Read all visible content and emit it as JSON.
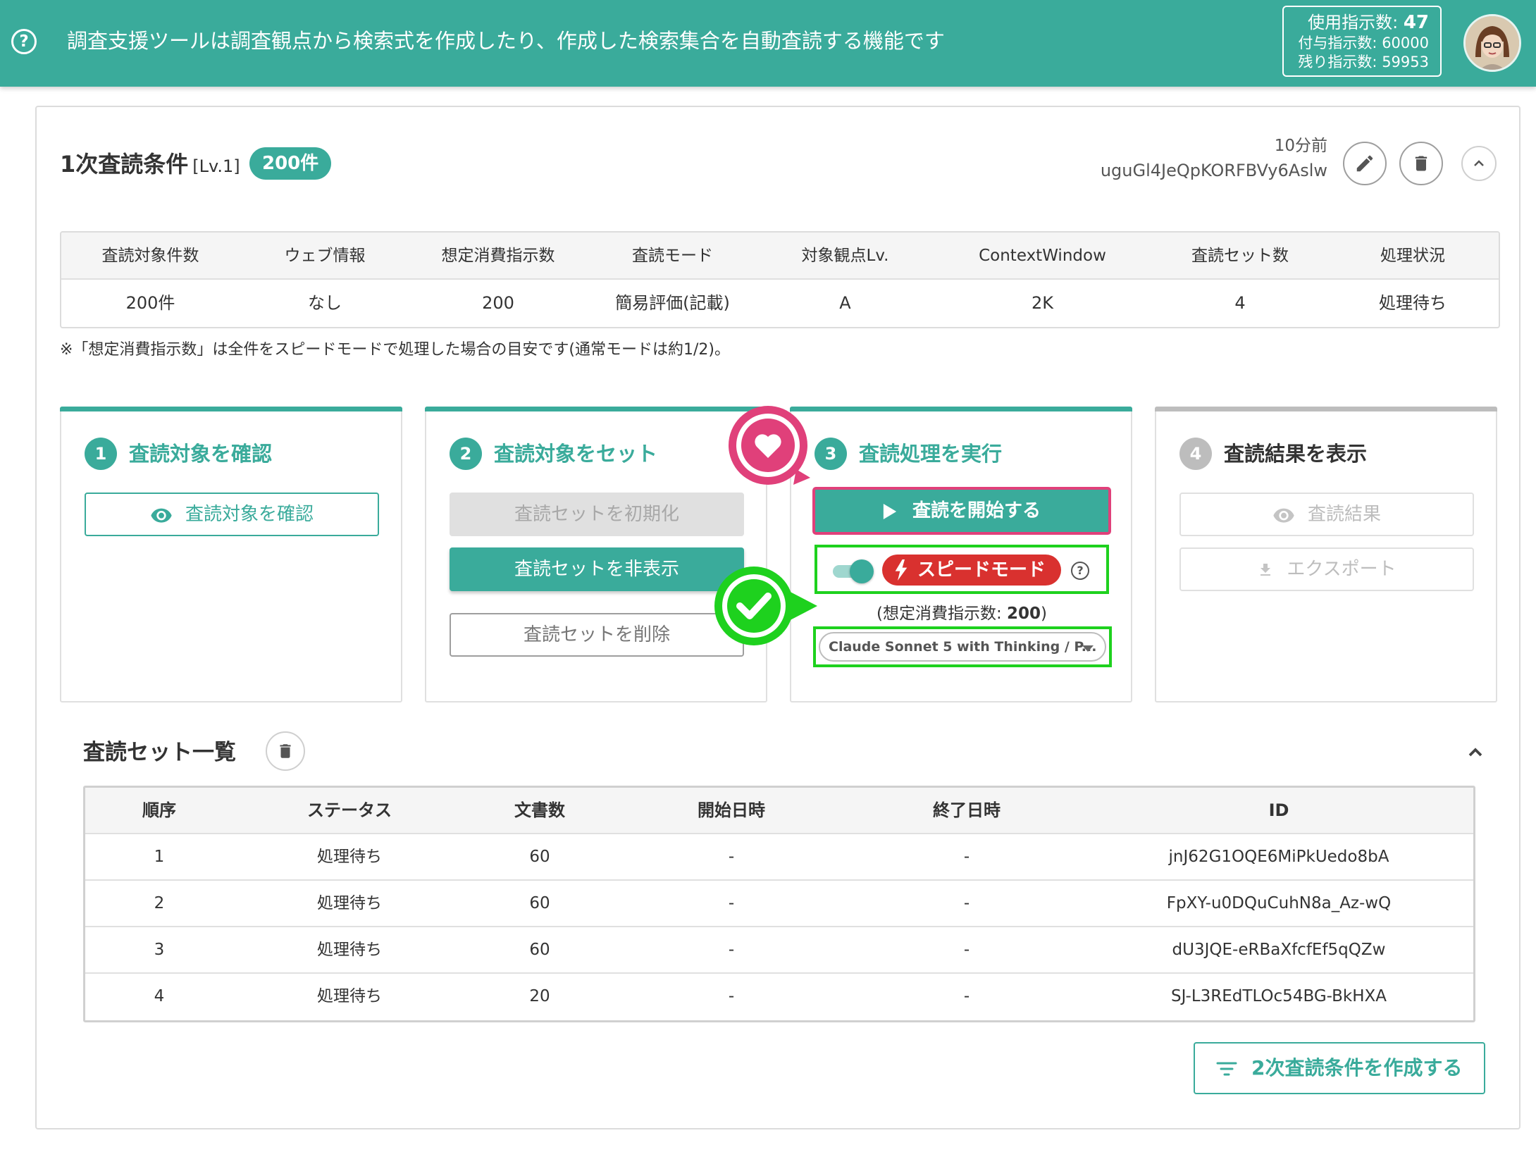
{
  "header": {
    "message": "調査支援ツールは調査観点から検索式を作成したり、作成した検索集合を自動査読する機能です",
    "usage_label": "使用指示数:",
    "usage_value": "47",
    "granted_label": "付与指示数:",
    "granted_value": "60000",
    "remaining_label": "残り指示数:",
    "remaining_value": "59953",
    "help_icon": "help-icon",
    "avatar_icon": "user-avatar"
  },
  "condition": {
    "title": "1次査読条件",
    "level": "[Lv.1]",
    "count_badge": "200件",
    "relative_time": "10分前",
    "id": "uguGl4JeQpKORFBVy6Aslw",
    "icons": [
      "edit-icon",
      "delete-icon",
      "chevron-up-icon"
    ]
  },
  "summary": {
    "headers": [
      "査読対象件数",
      "ウェブ情報",
      "想定消費指示数",
      "査読モード",
      "対象観点Lv.",
      "ContextWindow",
      "査読セット数",
      "処理状況"
    ],
    "values": [
      "200件",
      "なし",
      "200",
      "簡易評価(記載)",
      "A",
      "2K",
      "4",
      "処理待ち"
    ],
    "note": "※「想定消費指示数」は全件をスピードモードで処理した場合の目安です(通常モードは約1/2)。"
  },
  "steps": [
    {
      "number": "1",
      "title": "査読対象を確認",
      "buttons": [
        "査読対象を確認"
      ]
    },
    {
      "number": "2",
      "title": "査読対象をセット",
      "buttons": [
        "査読セットを初期化",
        "査読セットを非表示",
        "査読セットを削除"
      ]
    },
    {
      "number": "3",
      "title": "査読処理を実行",
      "buttons": [
        "査読を開始する"
      ],
      "speed_mode_label": "スピードモード",
      "speed_mode_on": true,
      "estimate_label": "(想定消費指示数: ",
      "estimate_value": "200",
      "estimate_close": ")",
      "model_selected": "Claude Sonnet 5 with Thinking / P..."
    },
    {
      "number": "4",
      "title": "査読結果を表示",
      "buttons": [
        "査読結果",
        "エクスポート"
      ]
    }
  ],
  "review_sets": {
    "title": "査読セット一覧",
    "headers": [
      "順序",
      "ステータス",
      "文書数",
      "開始日時",
      "終了日時",
      "ID"
    ],
    "rows": [
      [
        "1",
        "処理待ち",
        "60",
        "-",
        "-",
        "jnJ62G1OQE6MiPkUedo8bA"
      ],
      [
        "2",
        "処理待ち",
        "60",
        "-",
        "-",
        "FpXY-u0DQuCuhN8a_Az-wQ"
      ],
      [
        "3",
        "処理待ち",
        "60",
        "-",
        "-",
        "dU3JQE-eRBaXfcfEf5qQZw"
      ],
      [
        "4",
        "処理待ち",
        "20",
        "-",
        "-",
        "SJ-L3REdTLOc54BG-BkHXA"
      ]
    ]
  },
  "create_secondary_button": "2次査読条件を作成する",
  "colors": {
    "accent": "#3aab9b",
    "speed_chip": "#d9312f",
    "highlight_pink": "#e0407a",
    "highlight_green": "#1ed11e"
  }
}
